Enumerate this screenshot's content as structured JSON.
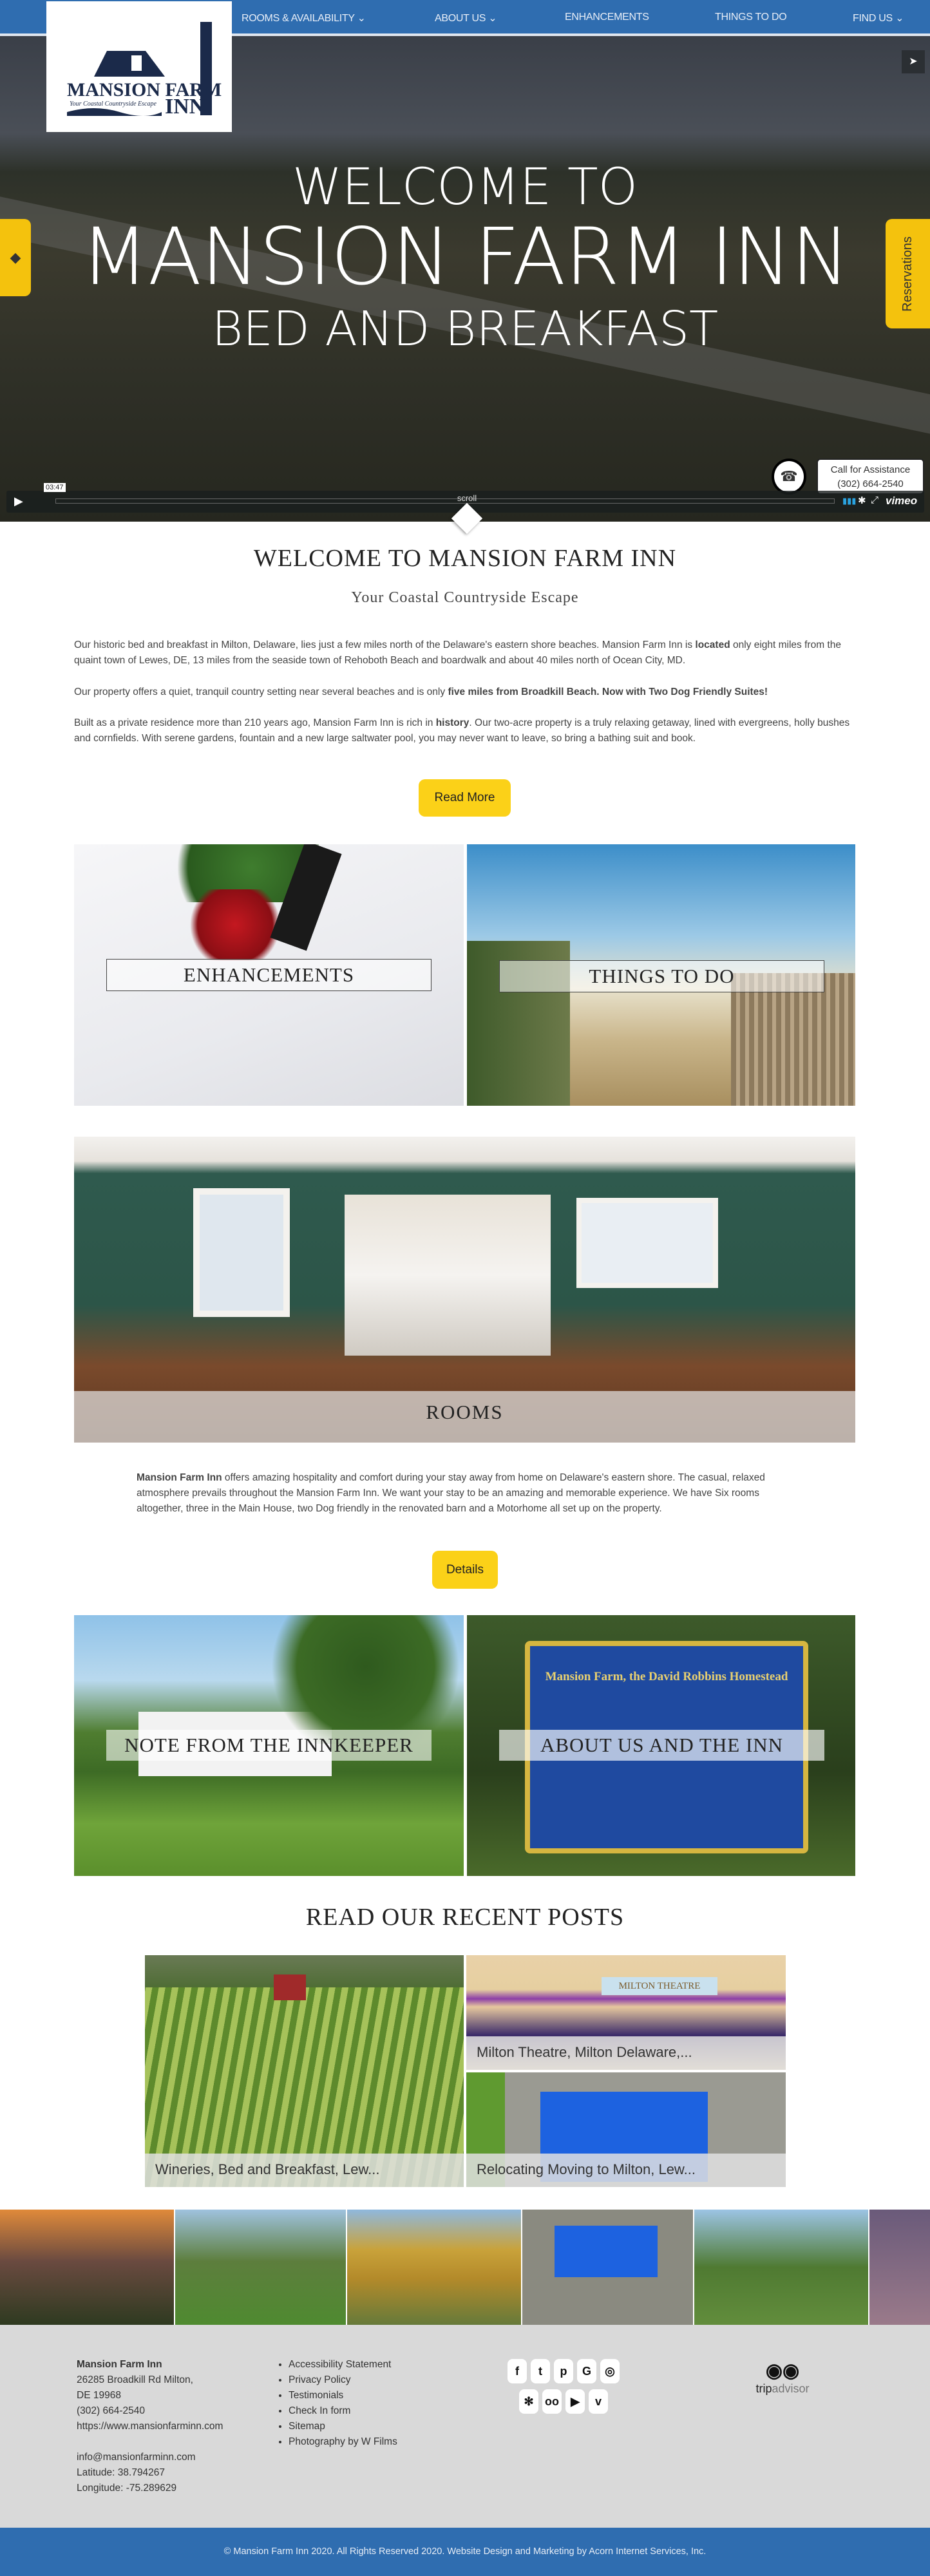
{
  "nav": {
    "items": [
      {
        "label": "ROOMS & AVAILABILITY",
        "chev": "⌄"
      },
      {
        "label": "ABOUT US",
        "chev": "⌄"
      },
      {
        "label": "ENHANCEMENTS"
      },
      {
        "label": "THINGS TO DO"
      },
      {
        "label": "FIND US",
        "chev": "⌄"
      }
    ]
  },
  "logo": {
    "text": "MANSION FARM INN",
    "tagline": "Your Coastal Countryside Escape"
  },
  "hero": {
    "line1": "WELCOME TO",
    "line2": "MANSION FARM INN",
    "line3": "BED AND BREAKFAST",
    "reservations": "Reservations",
    "video_time": "03:47",
    "scroll": "scroll",
    "vimeo": "vimeo",
    "call_label": "Call for Assistance",
    "call_phone": "(302) 664-2540"
  },
  "welcome": {
    "title": "WELCOME TO MANSION FARM INN",
    "subtitle": "Your Coastal Countryside Escape",
    "p1a": "Our historic bed and breakfast in Milton, Delaware, lies just a few miles north of the Delaware's eastern shore beaches. Mansion Farm Inn is ",
    "p1b": "located",
    "p1c": " only eight miles from the quaint town of Lewes, DE, 13 miles from the seaside town of Rehoboth Beach and boardwalk and about 40 miles north of Ocean City, MD.",
    "p2a": "Our property offers a quiet, tranquil country setting near several beaches and is only ",
    "p2b": "five miles from Broadkill Beach. Now with Two Dog Friendly Suites!",
    "p3a": "Built as a private residence more than 210 years ago, Mansion Farm Inn is rich in ",
    "p3b": "history",
    "p3c": ". Our two-acre property is a truly relaxing getaway, lined with evergreens, holly bushes and cornfields. With serene gardens, fountain and a new large saltwater pool, you may never want to leave, so bring a bathing suit and book.",
    "read_more": "Read More"
  },
  "tiles1": [
    "ENHANCEMENTS",
    "THINGS TO DO"
  ],
  "rooms": {
    "label": "ROOMS",
    "p_bold": "Mansion Farm Inn",
    "p_rest": " offers amazing hospitality and comfort during your stay away from home on Delaware's eastern shore. The casual, relaxed atmosphere prevails throughout the Mansion Farm Inn. We want your stay to be an amazing and memorable experience. We have Six rooms altogether, three in the Main House, two Dog friendly in the renovated barn and a Motorhome all set up on the property.",
    "details": "Details"
  },
  "tiles2": [
    "NOTE FROM THE INNKEEPER",
    "ABOUT US AND THE INN"
  ],
  "sign_text": "Mansion Farm, the David Robbins Homestead",
  "posts": {
    "title": "READ OUR RECENT POSTS",
    "items": [
      "Wineries, Bed and Breakfast, Lew...",
      "Milton Theatre, Milton Delaware,...",
      "Relocating Moving to Milton, Lew..."
    ],
    "theatre_sign": "MILTON THEATRE"
  },
  "footer": {
    "name": "Mansion Farm Inn",
    "address1": "26285 Broadkill Rd Milton,",
    "address2": "DE 19968",
    "phone": "(302) 664-2540",
    "url": "https://www.mansionfarminn.com",
    "email": "info@mansionfarminn.com",
    "lat": "Latitude: 38.794267",
    "lng": "Longitude: -75.289629",
    "links": [
      "Accessibility Statement",
      "Privacy Policy",
      "Testimonials",
      "Check In form",
      "Sitemap",
      "Photography by W Films"
    ],
    "social_row1": [
      "facebook-icon",
      "twitter-icon",
      "pinterest-icon",
      "google-icon",
      "instagram-icon"
    ],
    "social_row2": [
      "yelp-icon",
      "tripadvisor-icon",
      "youtube-icon",
      "vimeo-icon"
    ],
    "tripadvisor_a": "trip",
    "tripadvisor_b": "advisor",
    "copyright": "© Mansion Farm Inn 2020. All Rights Reserved 2020. Website Design and Marketing by Acorn Internet Services, Inc."
  },
  "colors": {
    "brand_blue": "#2f6db0",
    "accent_yellow": "#fbd118",
    "footer_gray": "#d9d9d9"
  }
}
